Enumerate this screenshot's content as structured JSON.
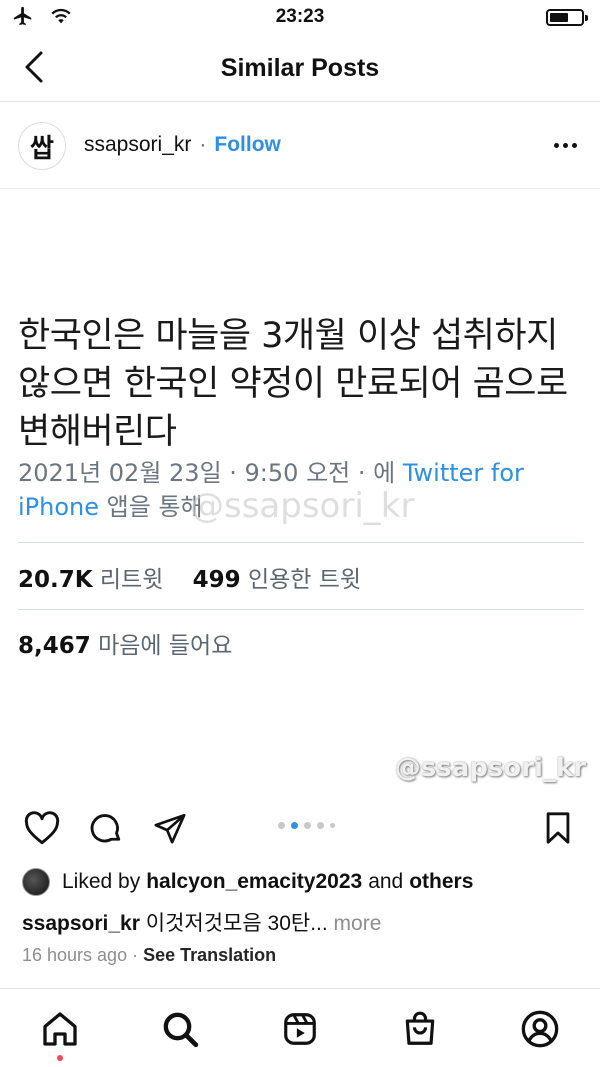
{
  "status_bar": {
    "time": "23:23",
    "battery_level": 0.6,
    "icons": [
      "airplane-icon",
      "wifi-icon",
      "battery-icon"
    ]
  },
  "header": {
    "title": "Similar Posts",
    "back_icon": "chevron-left-icon"
  },
  "post": {
    "avatar_text": "쌉",
    "username": "ssapsori_kr",
    "separator": "·",
    "follow_label": "Follow",
    "more_icon": "ellipsis-icon",
    "image": {
      "tweet_text": "한국인은 마늘을 3개월 이상 섭취하지 않으면 한국인 약정이 만료되어 곰으로 변해버린다",
      "meta_date": "2021년 02월 23일 · 9:50 오전 · 에",
      "meta_source": "Twitter for iPhone",
      "meta_suffix": "앱을 통해",
      "watermark_mid": "@ssapsori_kr",
      "retweets_count": "20.7K",
      "retweets_label": "리트윗",
      "quotes_count": "499",
      "quotes_label": "인용한 트윗",
      "likes_count": "8,467",
      "likes_label": "마음에 들어요",
      "watermark_bottom": "@ssapsori_kr"
    },
    "carousel": {
      "total": 5,
      "active_index": 1
    },
    "liked_by_prefix": "Liked by",
    "liked_by_user": "halcyon_emacity2023",
    "liked_by_and": "and",
    "liked_by_others": "others",
    "caption_user": "ssapsori_kr",
    "caption_text": "이것저것모음 30탄...",
    "caption_more": "more",
    "time_ago": "16 hours ago",
    "time_sep": "·",
    "see_translation": "See Translation"
  },
  "colors": {
    "link_blue": "#2f8fe0",
    "notification_red": "#ed4956"
  },
  "tabbar": {
    "items": [
      "home-icon",
      "search-icon",
      "reels-icon",
      "shop-icon",
      "profile-icon"
    ],
    "active": "home-icon"
  }
}
